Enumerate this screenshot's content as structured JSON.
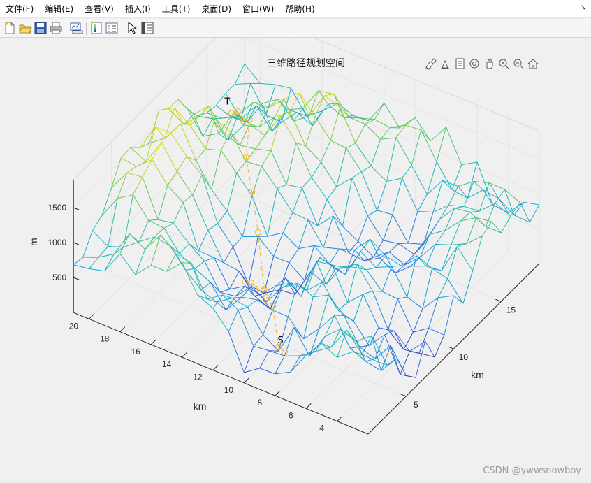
{
  "menubar": {
    "items": [
      {
        "label": "文件(F)"
      },
      {
        "label": "编辑(E)"
      },
      {
        "label": "查看(V)"
      },
      {
        "label": "插入(I)"
      },
      {
        "label": "工具(T)"
      },
      {
        "label": "桌面(D)"
      },
      {
        "label": "窗口(W)"
      },
      {
        "label": "帮助(H)"
      }
    ],
    "overflow_icon": "dock-arrow-icon"
  },
  "toolbar": {
    "buttons": [
      "new-figure-icon",
      "open-file-icon",
      "save-icon",
      "print-icon",
      "link-plot-icon",
      "insert-colorbar-icon",
      "insert-legend-icon",
      "edit-plot-icon",
      "property-inspector-icon"
    ]
  },
  "axes_toolbar": {
    "buttons": [
      "brush-icon",
      "data-tips-icon",
      "export-icon",
      "rotate-3d-icon",
      "pan-icon",
      "zoom-in-icon",
      "zoom-out-icon",
      "home-icon"
    ]
  },
  "chart_data": {
    "type": "surface-mesh-3d",
    "title": "三维路径规划空间",
    "xlabel": "km",
    "ylabel": "km",
    "zlabel": "m",
    "x_ticks": [
      "4",
      "6",
      "8",
      "10",
      "12",
      "14",
      "16",
      "18",
      "20"
    ],
    "y_ticks": [
      "5",
      "10",
      "15"
    ],
    "z_ticks": [
      "500",
      "1000",
      "1500"
    ],
    "xlim": [
      2,
      21
    ],
    "ylim": [
      1,
      19
    ],
    "zlim": [
      0,
      1900
    ],
    "grid": true,
    "colormap": [
      "#3e26a8",
      "#2e6ee0",
      "#16a8d6",
      "#2bc1a0",
      "#8bc93a",
      "#f0e31d"
    ],
    "path_color": "#f2b21b",
    "markers": [
      {
        "label": "S",
        "x": 8,
        "y": 2
      },
      {
        "label": "T",
        "x": 20,
        "y": 16
      }
    ],
    "path_waypoints": [
      {
        "x": 8,
        "y": 2
      },
      {
        "x": 9,
        "y": 3
      },
      {
        "x": 10,
        "y": 4
      },
      {
        "x": 11,
        "y": 5
      },
      {
        "x": 12,
        "y": 5
      },
      {
        "x": 13,
        "y": 6
      },
      {
        "x": 13,
        "y": 8
      },
      {
        "x": 14,
        "y": 9
      },
      {
        "x": 15,
        "y": 10
      },
      {
        "x": 16,
        "y": 11
      },
      {
        "x": 17,
        "y": 13
      },
      {
        "x": 18,
        "y": 14
      },
      {
        "x": 19,
        "y": 15
      },
      {
        "x": 20,
        "y": 16
      }
    ],
    "surface_note": "rough terrain mesh, high ridges at far corner, valley along the path"
  },
  "watermark": "CSDN @ywwsnowboy"
}
